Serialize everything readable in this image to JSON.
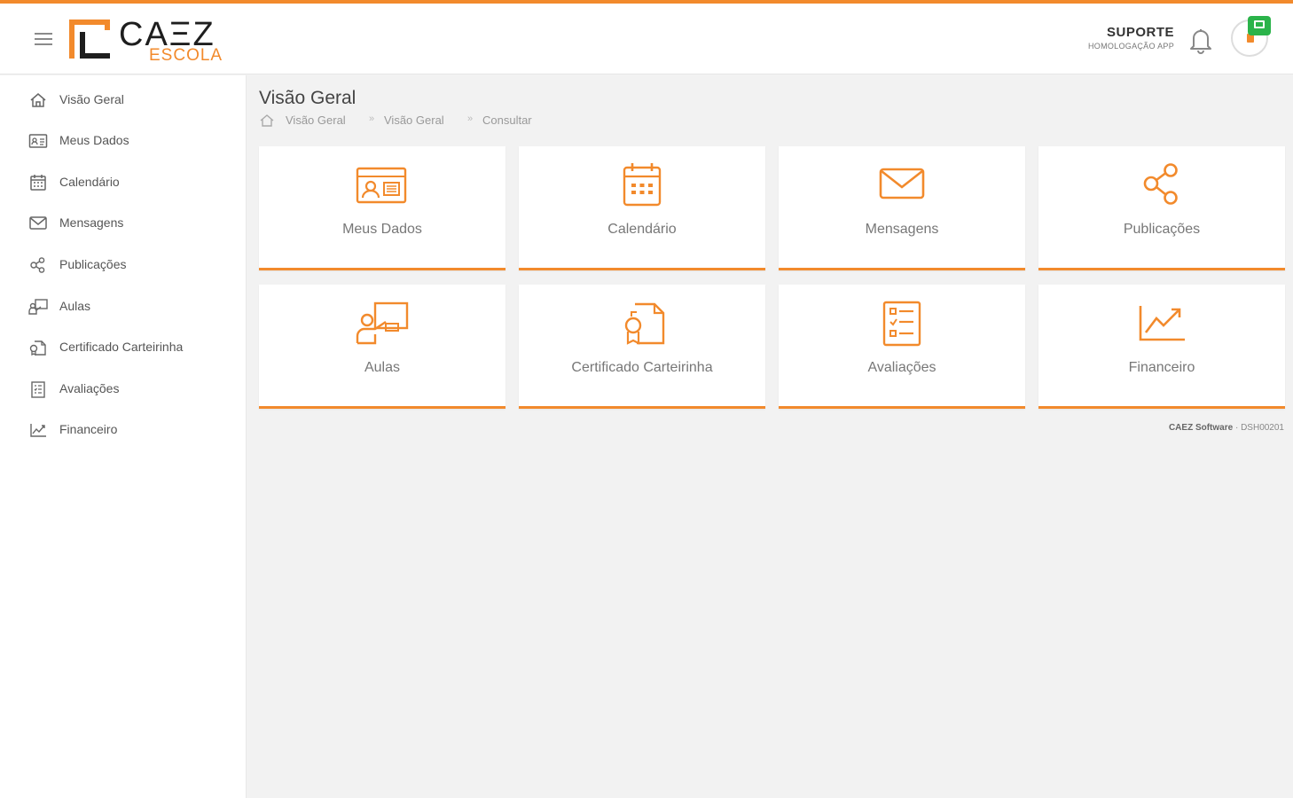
{
  "colors": {
    "accent": "#f28a2c",
    "presence": "#2bb34a"
  },
  "header": {
    "logo_text": "CAΞZ",
    "logo_sub": "ESCOLA",
    "support_name": "SUPORTE",
    "support_sub": "HOMOLOGAÇÃO APP"
  },
  "sidebar": {
    "items": [
      {
        "label": "Visão Geral",
        "icon": "home-icon"
      },
      {
        "label": "Meus Dados",
        "icon": "id-card-icon"
      },
      {
        "label": "Calendário",
        "icon": "calendar-icon"
      },
      {
        "label": "Mensagens",
        "icon": "envelope-icon"
      },
      {
        "label": "Publicações",
        "icon": "share-icon"
      },
      {
        "label": "Aulas",
        "icon": "teacher-icon"
      },
      {
        "label": "Certificado Carteirinha",
        "icon": "certificate-icon"
      },
      {
        "label": "Avaliações",
        "icon": "checklist-icon"
      },
      {
        "label": "Financeiro",
        "icon": "chart-up-icon"
      }
    ]
  },
  "main": {
    "title": "Visão Geral",
    "breadcrumb": [
      "Visão Geral",
      "Visão Geral",
      "Consultar"
    ],
    "tiles": [
      {
        "label": "Meus Dados",
        "icon": "id-card-icon"
      },
      {
        "label": "Calendário",
        "icon": "calendar-icon"
      },
      {
        "label": "Mensagens",
        "icon": "envelope-icon"
      },
      {
        "label": "Publicações",
        "icon": "share-icon"
      },
      {
        "label": "Aulas",
        "icon": "teacher-icon"
      },
      {
        "label": "Certificado Carteirinha",
        "icon": "certificate-icon"
      },
      {
        "label": "Avaliações",
        "icon": "checklist-icon"
      },
      {
        "label": "Financeiro",
        "icon": "chart-up-icon"
      }
    ],
    "footer_brand": "CAEZ Software",
    "footer_code": " · DSH00201"
  }
}
